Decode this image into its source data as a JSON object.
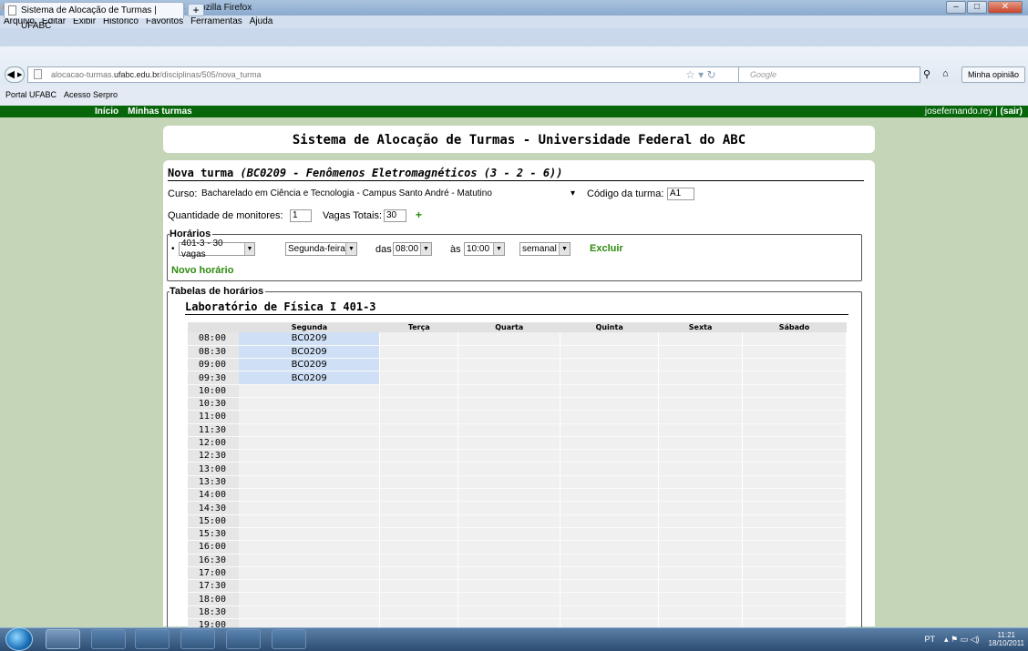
{
  "window": {
    "title": "Sistema de Alocação de Turmas | UFABC - Mozilla Firefox"
  },
  "menu": [
    "Arquivo",
    "Editar",
    "Exibir",
    "Histórico",
    "Favoritos",
    "Ferramentas",
    "Ajuda"
  ],
  "tab": {
    "label": "Sistema de Alocação de Turmas | UFABC",
    "add": "+"
  },
  "url": {
    "prefix": "alocacao-turmas.",
    "domain": "ufabc.edu.br",
    "path": "/disciplinas/505/nova_turma"
  },
  "search": {
    "placeholder": "Google"
  },
  "opinion_button": "Minha opinião",
  "bookmarks": [
    "Portal UFABC",
    "Acesso Serpro"
  ],
  "nav": {
    "links": [
      "Início",
      "Minhas turmas"
    ],
    "user": "josefernando.rey",
    "separator": "|",
    "logout": "(sair)"
  },
  "header": {
    "title": "Sistema de Alocação de Turmas - Universidade Federal do ABC"
  },
  "form": {
    "title_prefix": "Nova turma ",
    "title_course": "(BC0209 - Fenômenos Eletromagnéticos (3 - 2 - 6))",
    "curso_label": "Curso:",
    "curso_value": "Bacharelado em Ciência e Tecnologia - Campus Santo André - Matutino",
    "codigo_label": "Código da turma:",
    "codigo_value": "A1",
    "monitores_label": "Quantidade de monitores:",
    "monitores_value": "1",
    "vagas_label": "Vagas Totais:",
    "vagas_value": "30",
    "vagas_add": "+"
  },
  "horarios": {
    "legend": "Horários",
    "row": {
      "sala": "401-3 - 30 vagas",
      "dia": "Segunda-feira",
      "das_label": "das",
      "inicio": "08:00",
      "as_label": "às",
      "fim": "10:00",
      "freq": "semanal",
      "excluir": "Excluir"
    },
    "novo": "Novo horário"
  },
  "tabelas": {
    "legend": "Tabelas de horários",
    "title": "Laboratório de Física I 401-3",
    "days": [
      "Segunda",
      "Terça",
      "Quarta",
      "Quinta",
      "Sexta",
      "Sábado"
    ],
    "rows": [
      {
        "time": "08:00",
        "cells": [
          "BC0209",
          "",
          "",
          "",
          "",
          ""
        ]
      },
      {
        "time": "08:30",
        "cells": [
          "BC0209",
          "",
          "",
          "",
          "",
          ""
        ]
      },
      {
        "time": "09:00",
        "cells": [
          "BC0209",
          "",
          "",
          "",
          "",
          ""
        ]
      },
      {
        "time": "09:30",
        "cells": [
          "BC0209",
          "",
          "",
          "",
          "",
          ""
        ]
      },
      {
        "time": "10:00",
        "cells": [
          "",
          "",
          "",
          "",
          "",
          ""
        ]
      },
      {
        "time": "10:30",
        "cells": [
          "",
          "",
          "",
          "",
          "",
          ""
        ]
      },
      {
        "time": "11:00",
        "cells": [
          "",
          "",
          "",
          "",
          "",
          ""
        ]
      },
      {
        "time": "11:30",
        "cells": [
          "",
          "",
          "",
          "",
          "",
          ""
        ]
      },
      {
        "time": "12:00",
        "cells": [
          "",
          "",
          "",
          "",
          "",
          ""
        ]
      },
      {
        "time": "12:30",
        "cells": [
          "",
          "",
          "",
          "",
          "",
          ""
        ]
      },
      {
        "time": "13:00",
        "cells": [
          "",
          "",
          "",
          "",
          "",
          ""
        ]
      },
      {
        "time": "13:30",
        "cells": [
          "",
          "",
          "",
          "",
          "",
          ""
        ]
      },
      {
        "time": "14:00",
        "cells": [
          "",
          "",
          "",
          "",
          "",
          ""
        ]
      },
      {
        "time": "14:30",
        "cells": [
          "",
          "",
          "",
          "",
          "",
          ""
        ]
      },
      {
        "time": "15:00",
        "cells": [
          "",
          "",
          "",
          "",
          "",
          ""
        ]
      },
      {
        "time": "15:30",
        "cells": [
          "",
          "",
          "",
          "",
          "",
          ""
        ]
      },
      {
        "time": "16:00",
        "cells": [
          "",
          "",
          "",
          "",
          "",
          ""
        ]
      },
      {
        "time": "16:30",
        "cells": [
          "",
          "",
          "",
          "",
          "",
          ""
        ]
      },
      {
        "time": "17:00",
        "cells": [
          "",
          "",
          "",
          "",
          "",
          ""
        ]
      },
      {
        "time": "17:30",
        "cells": [
          "",
          "",
          "",
          "",
          "",
          ""
        ]
      },
      {
        "time": "18:00",
        "cells": [
          "",
          "",
          "",
          "",
          "",
          ""
        ]
      },
      {
        "time": "18:30",
        "cells": [
          "",
          "",
          "",
          "",
          "",
          ""
        ]
      },
      {
        "time": "19:00",
        "cells": [
          "",
          "",
          "",
          "",
          "",
          ""
        ]
      }
    ]
  },
  "taskbar": {
    "lang": "PT",
    "time": "11:21",
    "date": "18/10/2011"
  },
  "colors": {
    "nav_green": "#07650a",
    "link_green": "#2d8b0e",
    "page_bg": "#c4d6b7",
    "slot_filled": "#cfe0f6"
  }
}
